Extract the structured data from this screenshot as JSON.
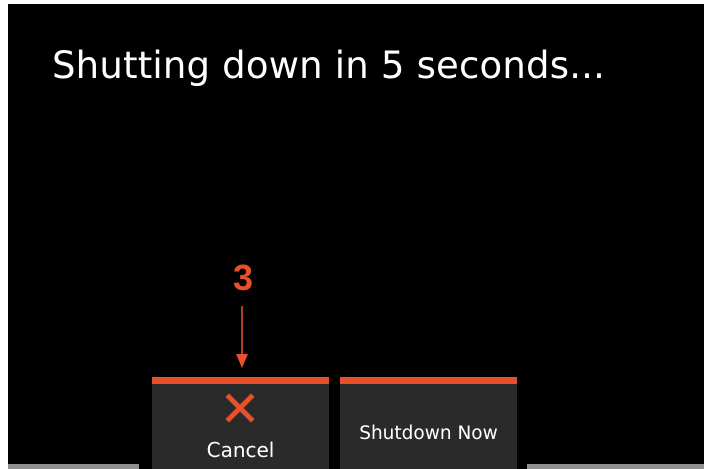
{
  "screen": {
    "message": "Shutting down in 5 seconds..."
  },
  "annotation": {
    "callout_number": "3",
    "color": "#e8502c"
  },
  "softkeys": {
    "cancel": {
      "icon": "close-icon",
      "label": "Cancel"
    },
    "shutdown_now": {
      "label": "Shutdown Now"
    }
  },
  "colors": {
    "background": "#000000",
    "softkey_background": "#2a2a2a",
    "accent": "#e8502c",
    "text": "#ffffff",
    "cancel_icon": "#e8502c"
  }
}
